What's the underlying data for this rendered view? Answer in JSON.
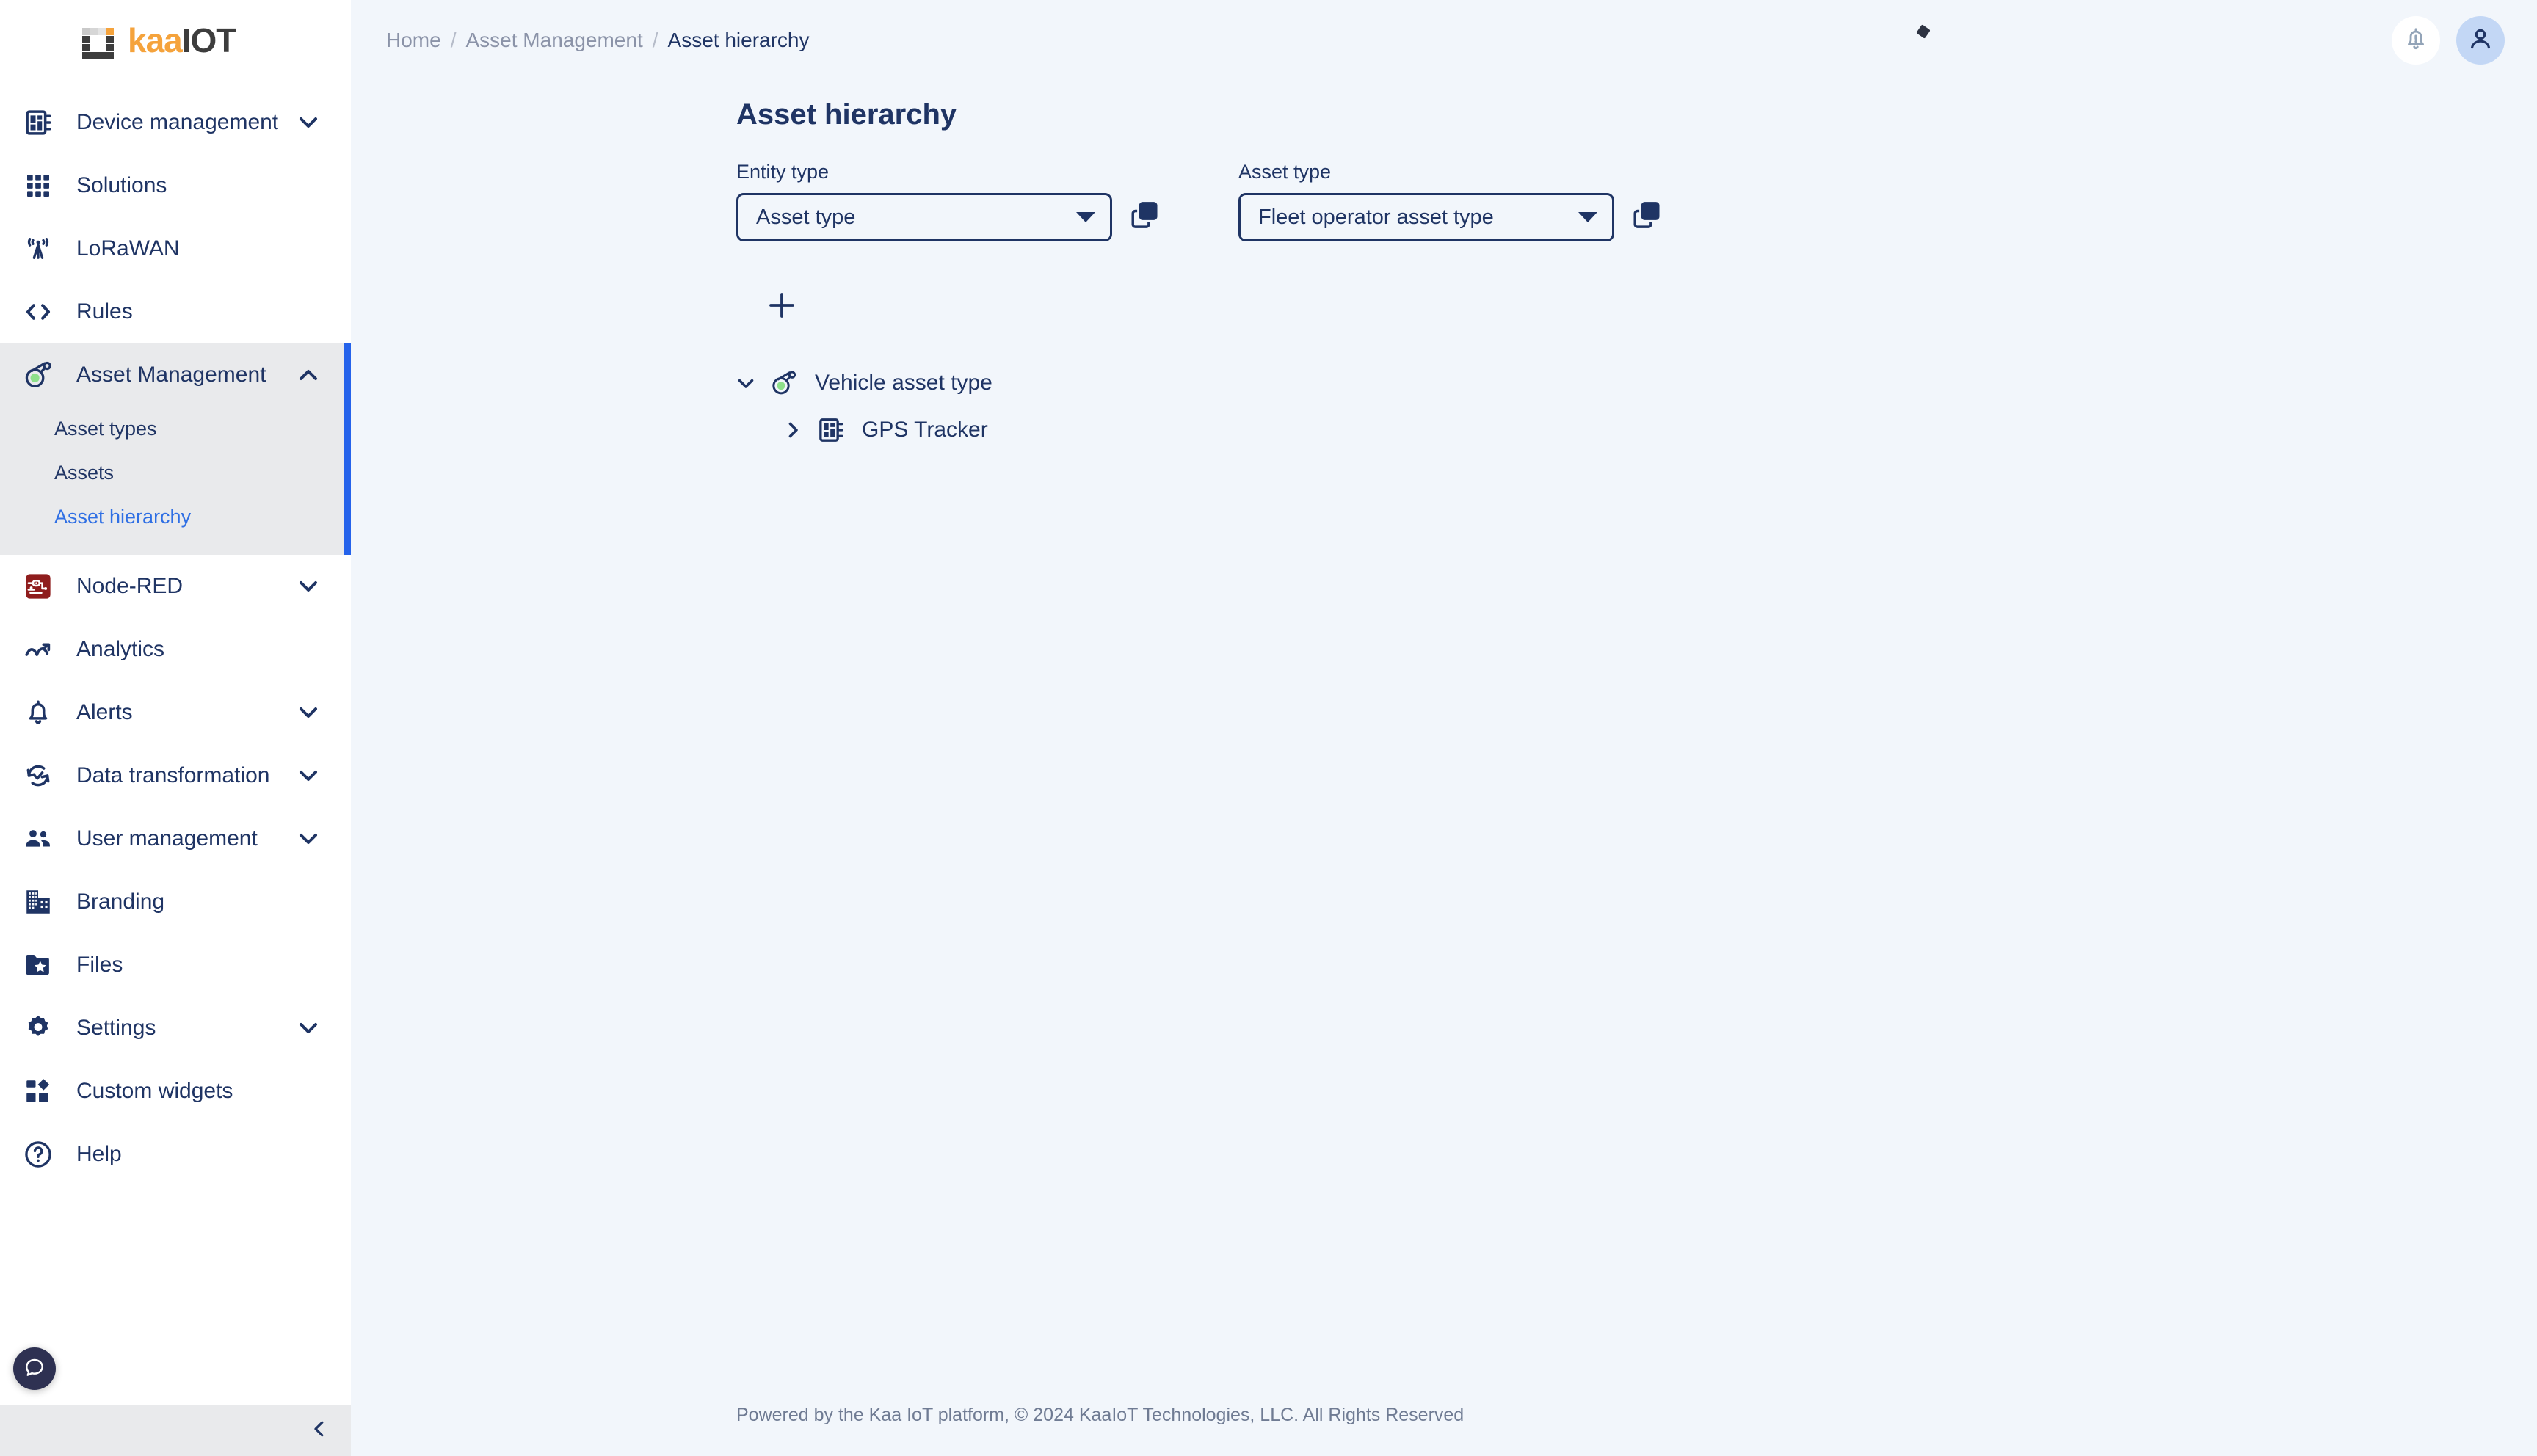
{
  "brand": {
    "name_part1": "kaa",
    "name_part2": "IOT",
    "orange": "#f5a33c",
    "dark": "#3d3d3d"
  },
  "sidebar": {
    "items": [
      {
        "label": "Device management",
        "icon": "chip-icon",
        "expandable": true,
        "expanded": false
      },
      {
        "label": "Solutions",
        "icon": "grid-icon",
        "expandable": false
      },
      {
        "label": "LoRaWAN",
        "icon": "antenna-icon",
        "expandable": false
      },
      {
        "label": "Rules",
        "icon": "code-brackets-icon",
        "expandable": false
      },
      {
        "label": "Asset Management",
        "icon": "asset-tag-icon",
        "expandable": true,
        "expanded": true
      },
      {
        "label": "Node-RED",
        "icon": "node-red-icon",
        "expandable": true,
        "expanded": false
      },
      {
        "label": "Analytics",
        "icon": "analytics-icon",
        "expandable": false
      },
      {
        "label": "Alerts",
        "icon": "bell-icon",
        "expandable": true,
        "expanded": false
      },
      {
        "label": "Data transformation",
        "icon": "refresh-check-icon",
        "expandable": true,
        "expanded": false
      },
      {
        "label": "User management",
        "icon": "people-icon",
        "expandable": true,
        "expanded": false
      },
      {
        "label": "Branding",
        "icon": "building-icon",
        "expandable": false
      },
      {
        "label": "Files",
        "icon": "folder-star-icon",
        "expandable": false
      },
      {
        "label": "Settings",
        "icon": "gear-icon",
        "expandable": true,
        "expanded": false
      },
      {
        "label": "Custom widgets",
        "icon": "widgets-icon",
        "expandable": false
      },
      {
        "label": "Help",
        "icon": "question-circle-icon",
        "expandable": false
      }
    ],
    "asset_management_submenu": [
      {
        "label": "Asset types",
        "active": false
      },
      {
        "label": "Assets",
        "active": false
      },
      {
        "label": "Asset hierarchy",
        "active": true
      }
    ],
    "active_color": "#2f6fe4",
    "indicator_color": "#2563eb",
    "expanded_bg": "#e9eaec"
  },
  "breadcrumb": {
    "items": [
      "Home",
      "Asset Management",
      "Asset hierarchy"
    ],
    "separator": "/"
  },
  "page": {
    "title": "Asset hierarchy"
  },
  "filters": {
    "entity_type": {
      "label": "Entity type",
      "value": "Asset type"
    },
    "asset_type": {
      "label": "Asset type",
      "value": "Fleet operator asset type"
    }
  },
  "toolbar": {
    "add_label": "+"
  },
  "tree": {
    "nodes": [
      {
        "label": "Vehicle asset type",
        "icon": "asset-tag-icon",
        "expanded": true,
        "level": 0
      },
      {
        "label": "GPS Tracker",
        "icon": "chip-icon",
        "expanded": false,
        "level": 1
      }
    ]
  },
  "footer": {
    "text": "Powered by the Kaa IoT platform, © 2024 KaaIoT Technologies, LLC. All Rights Reserved"
  },
  "icons": {
    "notifications": "bell-alert-icon",
    "account": "user-avatar-icon",
    "chat": "chat-bubble-icon",
    "collapse": "chevron-left-icon",
    "copy": "copy-icon"
  }
}
